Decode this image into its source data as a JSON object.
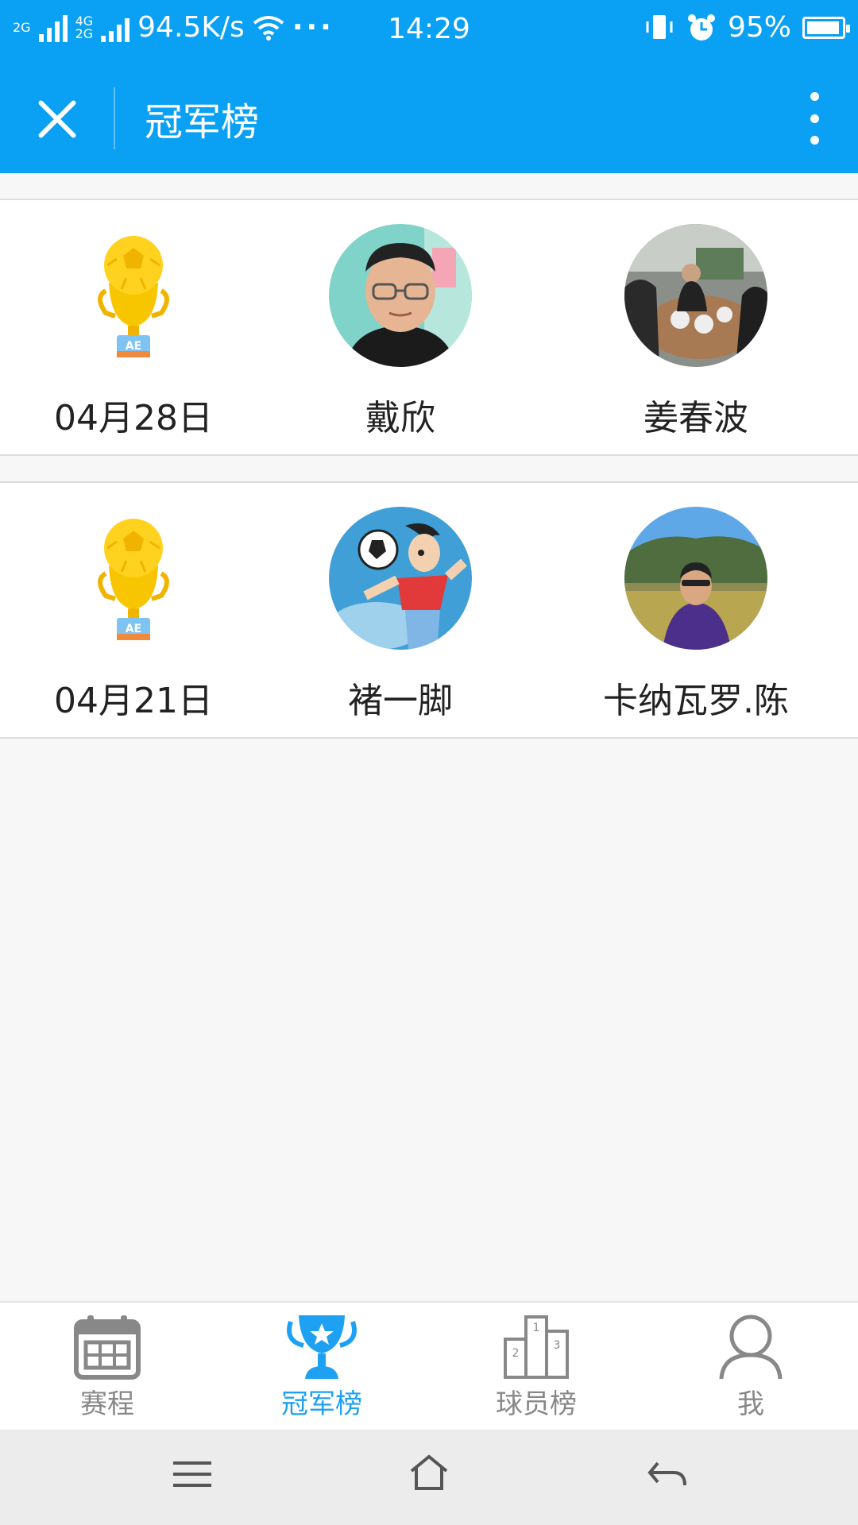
{
  "status_bar": {
    "net_type_1": "2G",
    "net_type_2": "4G",
    "net_type_3": "2G",
    "speed": "94.5K/s",
    "time": "14:29",
    "battery_percent": "95%",
    "battery_level": 0.95,
    "icons": [
      "signal-icon",
      "signal-icon",
      "wifi-icon",
      "more-dots-icon",
      "vibrate-icon",
      "alarm-icon",
      "battery-icon"
    ]
  },
  "title_bar": {
    "title": "冠军榜",
    "close_icon": "close-icon",
    "more_icon": "more-vertical-icon"
  },
  "champions": [
    {
      "date": "04月28日",
      "players": [
        "戴欣",
        "姜春波"
      ]
    },
    {
      "date": "04月21日",
      "players": [
        "褚一脚",
        "卡纳瓦罗.陈"
      ]
    }
  ],
  "tab_bar": {
    "active_index": 1,
    "active_color": "#1ea1f2",
    "inactive_color": "#888888",
    "tabs": [
      {
        "label": "赛程",
        "icon": "calendar-icon"
      },
      {
        "label": "冠军榜",
        "icon": "trophy-icon"
      },
      {
        "label": "球员榜",
        "icon": "podium-icon"
      },
      {
        "label": "我",
        "icon": "user-icon"
      }
    ]
  },
  "system_nav": {
    "icons": [
      "menu-icon",
      "home-icon",
      "back-icon"
    ]
  },
  "colors": {
    "primary": "#0aa0f4",
    "trophy_gold": "#f7c600"
  }
}
